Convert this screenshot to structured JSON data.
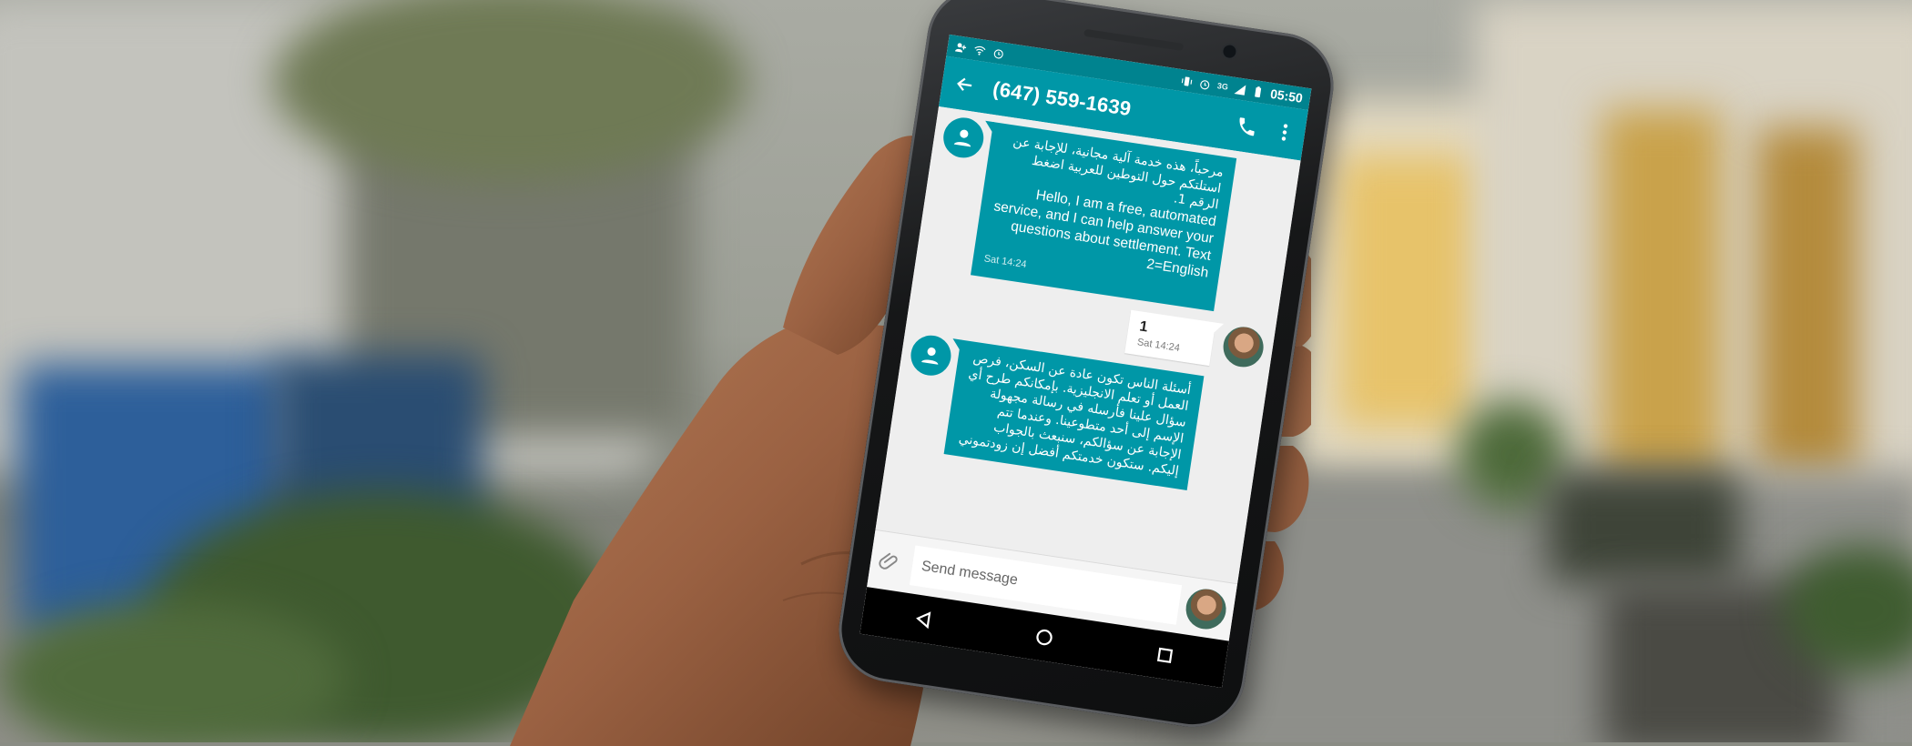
{
  "status_bar": {
    "time": "05:50",
    "network": "3G",
    "left_icons": [
      "person-add-icon",
      "wifi-icon",
      "alarm-icon"
    ],
    "right_icons": [
      "vibrate-icon",
      "alarm-icon",
      "signal-icon",
      "battery-icon"
    ]
  },
  "app_bar": {
    "title": "(647) 559-1639",
    "back_icon": "arrow-back-icon",
    "call_icon": "phone-icon",
    "menu_icon": "more-vert-icon"
  },
  "messages": [
    {
      "direction": "incoming",
      "avatar_icon": "person-icon",
      "text_ar": "مرحباً، هذه خدمة آلية مجانية، للإجابة عن استلتكم حول التوطين للعربية اضغط الرقم 1.",
      "text_en": "Hello, I am a free, automated service, and I can help answer your questions about settlement.  Text 2=English",
      "time": "Sat 14:24"
    },
    {
      "direction": "outgoing",
      "text": "1",
      "time": "Sat 14:24"
    },
    {
      "direction": "incoming",
      "avatar_icon": "person-icon",
      "text_ar": "أسئلة الناس تكون عادة عن السكن، فرص العمل أو تعلم الانجليزية. بإمكانكم طرح أي سؤال علينا فأرسله في رسالة مجهولة الإسم إلى أحد متطوعينا. وعندما تتم الإجابة عن سؤالكم، سنبعث بالجواب إليكم. ستكون خدمتكم أفضل إن زودتموني",
      "time": ""
    }
  ],
  "composer": {
    "placeholder": "Send message",
    "attach_icon": "paperclip-icon"
  },
  "nav_bar": [
    "back-triangle-icon",
    "home-circle-icon",
    "recents-square-icon"
  ],
  "colors": {
    "accent": "#0097a7",
    "status_bar": "#00838f",
    "thread_bg": "#eeeeee"
  }
}
